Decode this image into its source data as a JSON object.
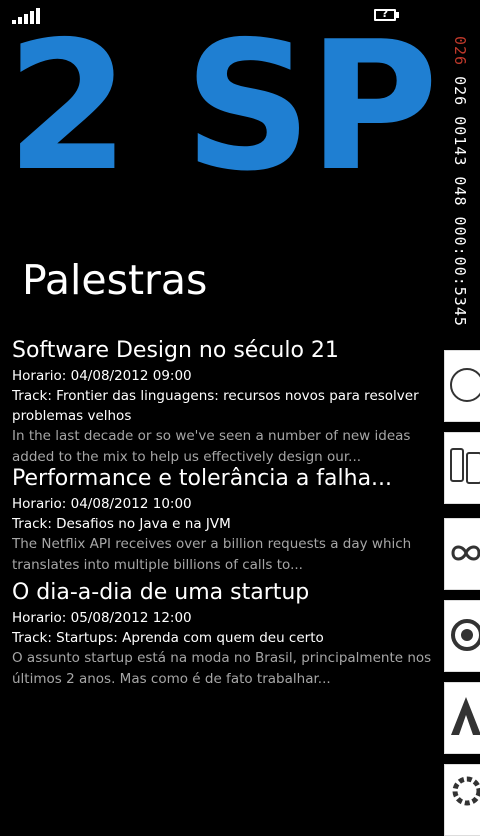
{
  "status_bar": {
    "battery_mark": "?"
  },
  "hero": {
    "title": "2 SP"
  },
  "page": {
    "title": "Palestras"
  },
  "talks": [
    {
      "title": "Software Design no século 21",
      "time": "Horario: 04/08/2012 09:00",
      "track": "Track: Frontier das linguagens: recursos novos para resolver problemas velhos",
      "description": "In the last decade or so we've seen a number of new ideas added to the mix to help us effectively design our..."
    },
    {
      "title": "Performance e tolerância a falha...",
      "time": "Horario: 04/08/2012 10:00",
      "track": "Track: Desafios no Java e na JVM",
      "description": "The Netflix API receives over a billion requests a day which translates into multiple billions of calls to..."
    },
    {
      "title": "O dia-a-dia de uma startup",
      "time": "Horario: 05/08/2012 12:00",
      "track": "Track: Startups: Aprenda com quem deu certo",
      "description": "O assunto startup está na moda no Brasil, principalmente nos últimos 2 anos. Mas como é de fato trabalhar..."
    }
  ],
  "side_strip": {
    "red_text": "026",
    "text": "026 00143 048 000:00:5345"
  },
  "colors": {
    "accent": "#1f7fd2",
    "background": "#000000",
    "secondary_text": "#a6a6a6"
  }
}
